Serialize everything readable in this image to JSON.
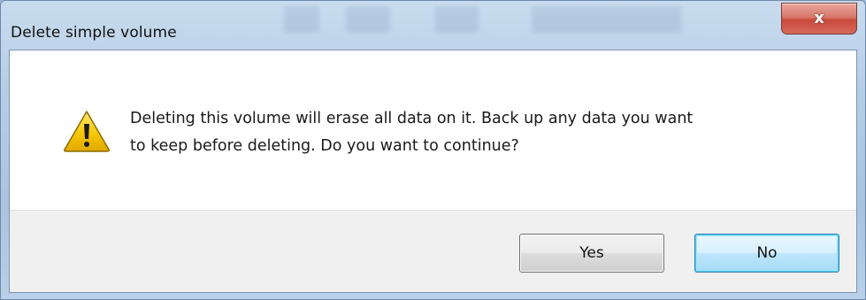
{
  "window": {
    "title": "Delete simple volume",
    "close_label": "x"
  },
  "message": {
    "icon": "warning-icon",
    "text": "Deleting this volume will erase all data on it. Back up any data you want\nto keep before deleting. Do you want to continue?"
  },
  "buttons": {
    "yes_label": "Yes",
    "no_label": "No"
  },
  "colors": {
    "close_button": "#c9493b",
    "default_button_border": "#3c7fb1",
    "warning_fill": "#f5c400"
  }
}
